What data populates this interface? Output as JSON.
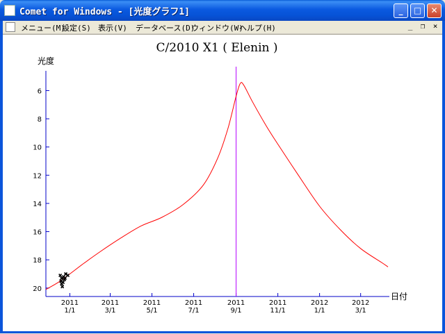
{
  "window": {
    "title": "Comet for Windows - [光度グラフ1]",
    "controls": {
      "minimize": "_",
      "maximize": "□",
      "close": "✕"
    }
  },
  "menubar": {
    "items": [
      {
        "label": "メニュー(M)"
      },
      {
        "label": "設定(S)"
      },
      {
        "label": "表示(V)"
      },
      {
        "label": "データベース(D)"
      },
      {
        "label": "ウィンドウ(W)"
      },
      {
        "label": "ヘルプ(H)"
      }
    ],
    "mdi_controls": {
      "minimize": "_",
      "restore": "❐",
      "close": "×"
    }
  },
  "chart_data": {
    "type": "line",
    "title": "C/2010 X1 ( Elenin )",
    "ylabel": "光度",
    "xlabel": "日付",
    "y_inverted": true,
    "ylim": [
      4.6,
      20.6
    ],
    "yticks": [
      6,
      8,
      10,
      12,
      14,
      16,
      18,
      20
    ],
    "xlim": [
      "2010-11-27",
      "2012-04-12"
    ],
    "xticks": [
      {
        "date": "2011-01-01",
        "line1": "2011",
        "line2": "1/1"
      },
      {
        "date": "2011-03-01",
        "line1": "2011",
        "line2": "3/1"
      },
      {
        "date": "2011-05-01",
        "line1": "2011",
        "line2": "5/1"
      },
      {
        "date": "2011-07-01",
        "line1": "2011",
        "line2": "7/1"
      },
      {
        "date": "2011-09-01",
        "line1": "2011",
        "line2": "9/1"
      },
      {
        "date": "2011-11-01",
        "line1": "2011",
        "line2": "11/1"
      },
      {
        "date": "2012-01-01",
        "line1": "2012",
        "line2": "1/1"
      },
      {
        "date": "2012-03-01",
        "line1": "2012",
        "line2": "3/1"
      }
    ],
    "current_date_marker": "2011-09-01",
    "predicted_curve": {
      "color": "#ff0000",
      "points": [
        [
          "2010-11-27",
          20.1
        ],
        [
          "2010-12-15",
          19.6
        ],
        [
          "2011-01-01",
          19.0
        ],
        [
          "2011-01-20",
          18.3
        ],
        [
          "2011-02-15",
          17.4
        ],
        [
          "2011-03-15",
          16.5
        ],
        [
          "2011-04-15",
          15.6
        ],
        [
          "2011-05-15",
          15.0
        ],
        [
          "2011-06-15",
          14.1
        ],
        [
          "2011-07-15",
          12.7
        ],
        [
          "2011-08-05",
          10.8
        ],
        [
          "2011-08-20",
          8.7
        ],
        [
          "2011-09-01",
          6.4
        ],
        [
          "2011-09-07",
          5.5
        ],
        [
          "2011-09-12",
          5.6
        ],
        [
          "2011-09-25",
          6.8
        ],
        [
          "2011-10-15",
          8.5
        ],
        [
          "2011-11-01",
          9.8
        ],
        [
          "2011-12-01",
          12.0
        ],
        [
          "2012-01-01",
          14.2
        ],
        [
          "2012-02-01",
          15.9
        ],
        [
          "2012-03-01",
          17.2
        ],
        [
          "2012-04-01",
          18.2
        ],
        [
          "2012-04-10",
          18.5
        ]
      ]
    },
    "observations": {
      "color": "#000000",
      "points": [
        [
          "2010-12-18",
          19.1
        ],
        [
          "2010-12-20",
          19.3
        ],
        [
          "2010-12-19",
          19.5
        ],
        [
          "2010-12-22",
          19.6
        ],
        [
          "2010-12-23",
          19.2
        ],
        [
          "2010-12-21",
          19.9
        ],
        [
          "2010-12-24",
          19.4
        ],
        [
          "2010-12-26",
          19.0
        ],
        [
          "2010-12-20",
          19.7
        ],
        [
          "2010-12-29",
          19.1
        ],
        [
          "2010-12-25",
          19.3
        ]
      ]
    }
  }
}
